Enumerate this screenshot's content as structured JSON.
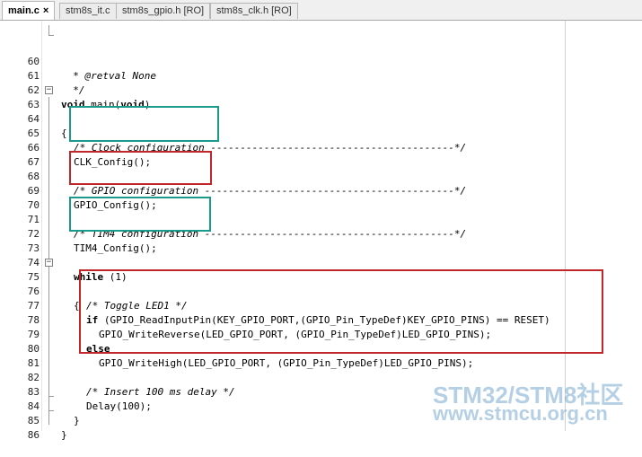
{
  "tabs": [
    {
      "label": "main.c",
      "close": "×"
    },
    {
      "label": "stm8s_it.c"
    },
    {
      "label": "stm8s_gpio.h [RO]"
    },
    {
      "label": "stm8s_clk.h [RO]"
    }
  ],
  "lines": [
    {
      "n": "60",
      "text": "  * @retval None"
    },
    {
      "n": "61",
      "text": "  */"
    },
    {
      "n": "62",
      "text": "void main(void)"
    },
    {
      "n": "63",
      "text": "{"
    },
    {
      "n": "64",
      "text": ""
    },
    {
      "n": "65",
      "text": "  /* Clock configuration -----------------------------------------*/"
    },
    {
      "n": "66",
      "text": "  CLK_Config();"
    },
    {
      "n": "67",
      "text": ""
    },
    {
      "n": "68",
      "text": "  /* GPIO configuration ------------------------------------------*/"
    },
    {
      "n": "69",
      "text": "  GPIO_Config();"
    },
    {
      "n": "70",
      "text": ""
    },
    {
      "n": "71",
      "text": "  /* TIM4 configuration ------------------------------------------*/"
    },
    {
      "n": "72",
      "text": "  TIM4_Config();"
    },
    {
      "n": "73",
      "text": ""
    },
    {
      "n": "74",
      "text": "  while (1)"
    },
    {
      "n": "75",
      "text": "  {"
    },
    {
      "n": "76",
      "text": "    /* Toggle LED1 */"
    },
    {
      "n": "77",
      "text": "    if (GPIO_ReadInputPin(KEY_GPIO_PORT,(GPIO_Pin_TypeDef)KEY_GPIO_PINS) == RESET)"
    },
    {
      "n": "78",
      "text": "      GPIO_WriteReverse(LED_GPIO_PORT, (GPIO_Pin_TypeDef)LED_GPIO_PINS);"
    },
    {
      "n": "79",
      "text": "    else"
    },
    {
      "n": "80",
      "text": "      GPIO_WriteHigh(LED_GPIO_PORT, (GPIO_Pin_TypeDef)LED_GPIO_PINS);"
    },
    {
      "n": "81",
      "text": ""
    },
    {
      "n": "82",
      "text": "    /* Insert 100 ms delay */"
    },
    {
      "n": "83",
      "text": "    Delay(100);"
    },
    {
      "n": "84",
      "text": "  }"
    },
    {
      "n": "85",
      "text": "}"
    },
    {
      "n": "86",
      "text": ""
    }
  ],
  "code_parts": {
    "l60": "  * @retval None",
    "l61": "  */",
    "l62_kw1": "void",
    "l62_mid": " main(",
    "l62_kw2": "void",
    "l62_end": ")",
    "l63": "{",
    "l65": "/* Clock configuration -----------------------------------------*/",
    "l66": "CLK_Config();",
    "l68": "/* GPIO configuration ------------------------------------------*/",
    "l69": "GPIO_Config();",
    "l71": "/* TIM4 configuration ------------------------------------------*/",
    "l72": "TIM4_Config();",
    "l74_kw": "while",
    "l74_rest": " (1)",
    "l75": "{",
    "l76": "/* Toggle LED1 */",
    "l77_kw": "if",
    "l77_rest": " (GPIO_ReadInputPin(KEY_GPIO_PORT,(GPIO_Pin_TypeDef)KEY_GPIO_PINS) == RESET)",
    "l78": "GPIO_WriteReverse(LED_GPIO_PORT, (GPIO_Pin_TypeDef)LED_GPIO_PINS);",
    "l79_kw": "else",
    "l80": "GPIO_WriteHigh(LED_GPIO_PORT, (GPIO_Pin_TypeDef)LED_GPIO_PINS);",
    "l82": "/* Insert 100 ms delay */",
    "l83": "Delay(100);",
    "l84": "}",
    "l85": "}"
  },
  "fold_markers": {
    "minus": "−"
  },
  "watermark": {
    "line1": "STM32/STM8社区",
    "line2": "www.stmcu.org.cn"
  },
  "colors": {
    "teal_box": "#1a9a8a",
    "red_box": "#c0262a"
  }
}
